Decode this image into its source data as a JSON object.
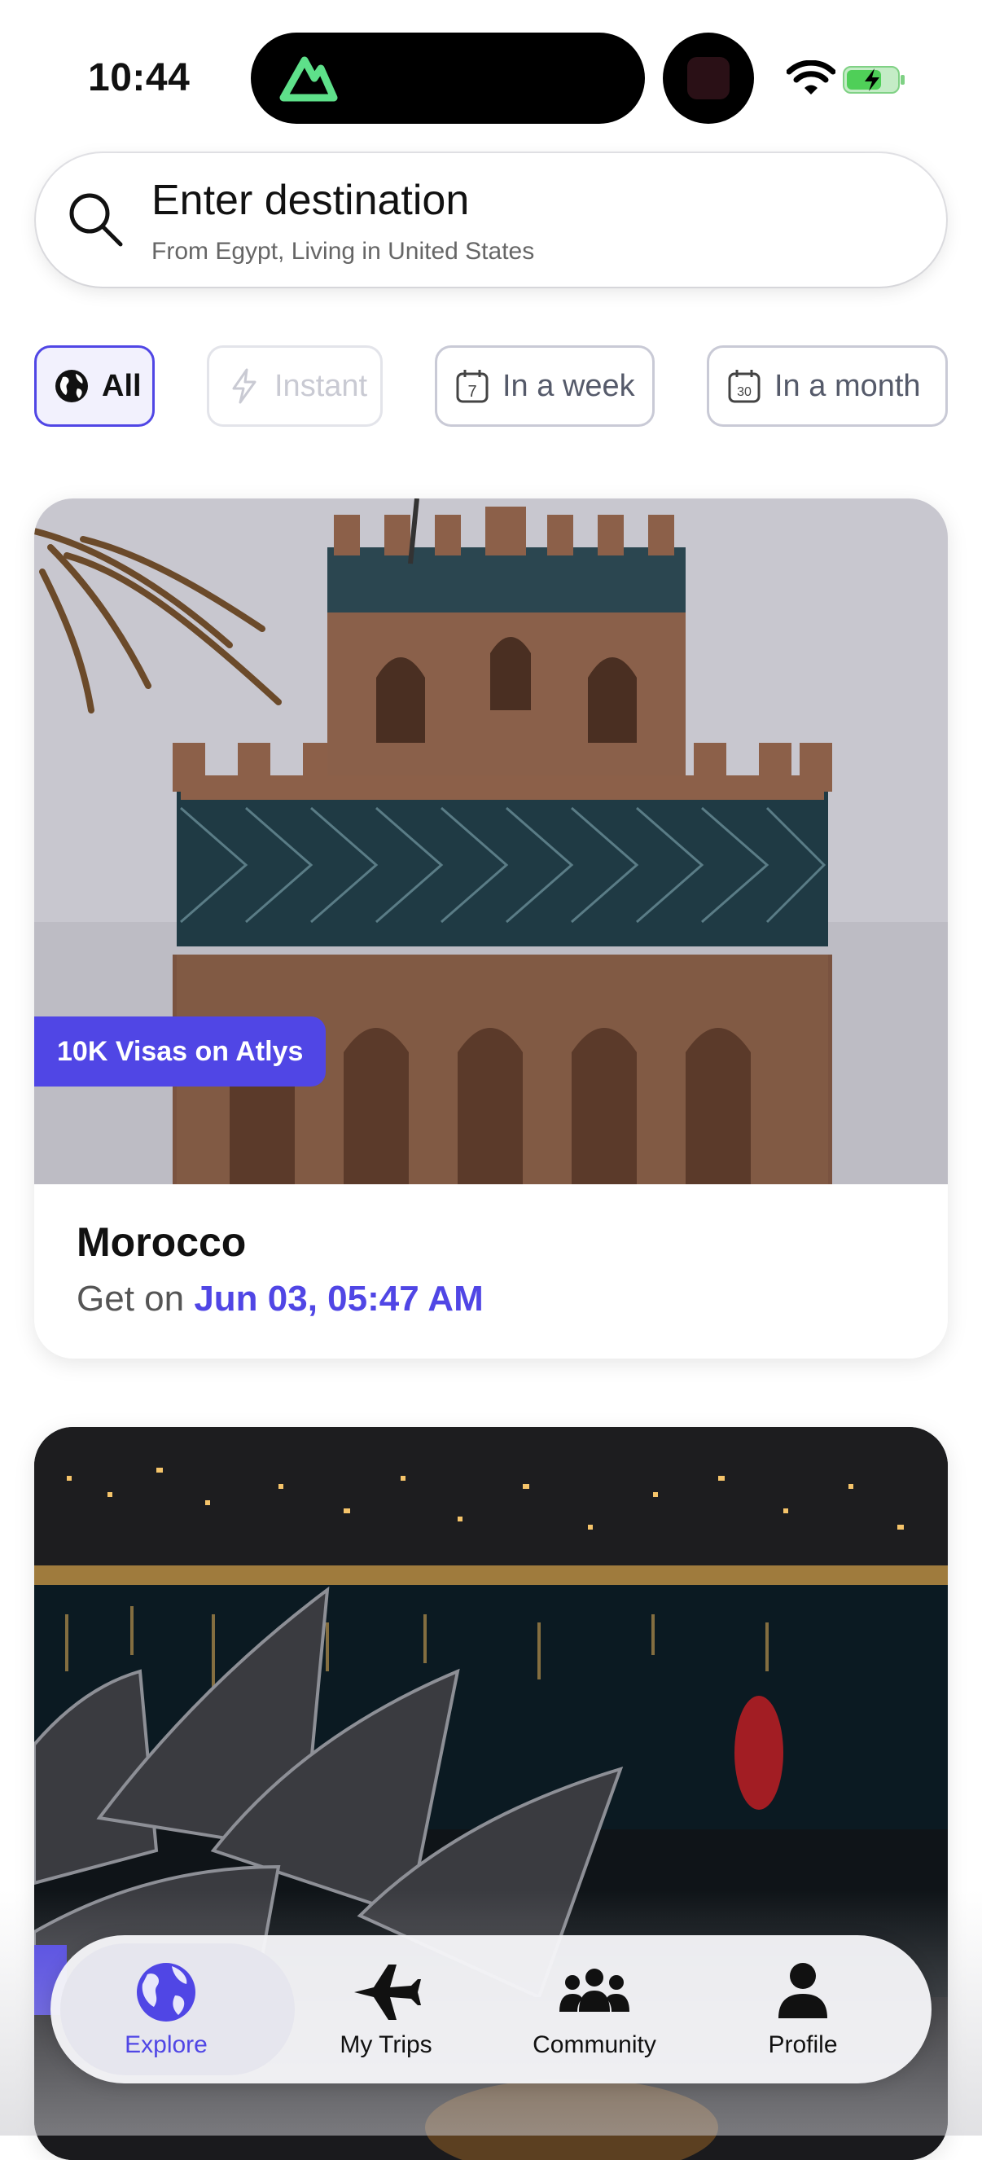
{
  "status_bar": {
    "time": "10:44"
  },
  "search": {
    "title": "Enter destination",
    "subtitle": "From Egypt, Living in United States",
    "icon": "search-icon"
  },
  "filters": {
    "all": "All",
    "instant": "Instant",
    "week": "In a week",
    "week_icon_num": "7",
    "month": "In a month",
    "month_icon_num": "30",
    "selected": "All"
  },
  "cards": [
    {
      "badge": "10K Visas on Atlys",
      "title": "Morocco",
      "get_on_prefix": "Get on",
      "date": "Jun 03, 05:47 AM"
    }
  ],
  "tabs": {
    "explore": "Explore",
    "trips": "My Trips",
    "community": "Community",
    "profile": "Profile",
    "active": "Explore"
  },
  "colors": {
    "accent": "#5046e5",
    "text": "#111111",
    "muted": "#666666"
  }
}
